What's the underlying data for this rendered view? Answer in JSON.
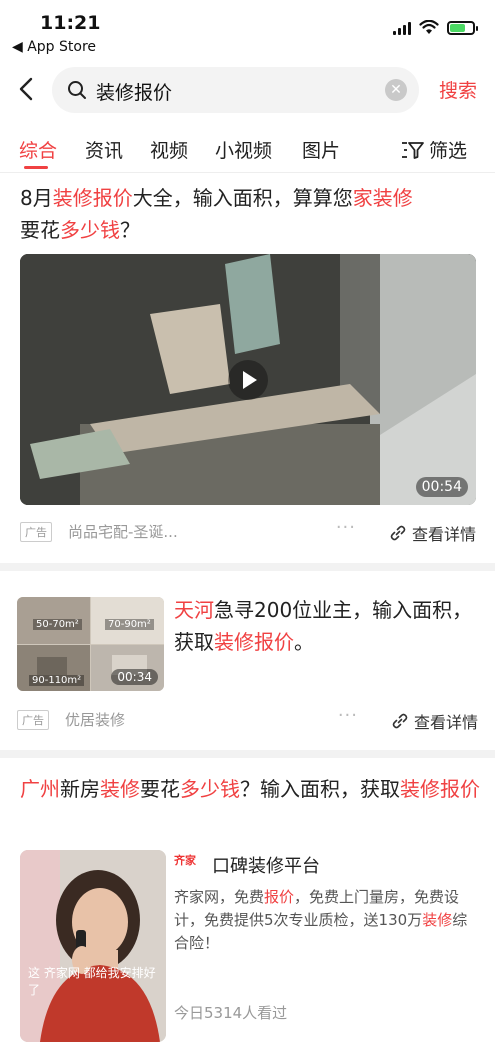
{
  "status_bar": {
    "time": "11:21",
    "back_app": "◀ App Store"
  },
  "search": {
    "query": "装修报价",
    "submit_label": "搜索"
  },
  "tabs": [
    {
      "label": "综合",
      "active": true
    },
    {
      "label": "资讯",
      "active": false
    },
    {
      "label": "视频",
      "active": false
    },
    {
      "label": "小视频",
      "active": false
    },
    {
      "label": "图片",
      "active": false
    }
  ],
  "filter_label": "筛选",
  "card1": {
    "title_parts": [
      "8月",
      "装修报价",
      "大全，输入面积，算算您",
      "家装修",
      "要花",
      "多少钱",
      "？"
    ],
    "duration": "00:54",
    "ad_tag": "广告",
    "advertiser": "尚品宅配-圣诞...",
    "more": "···",
    "detail_label": "查看详情"
  },
  "card2": {
    "title_parts": [
      "天河",
      "急寻200位业主，输入面积，获取",
      "装修报价",
      "。"
    ],
    "thumb_labels": [
      "50-70m²",
      "70-90m²",
      "90-110m²"
    ],
    "duration": "00:34",
    "ad_tag": "广告",
    "advertiser": "优居装修",
    "more": "···",
    "detail_label": "查看详情"
  },
  "card3": {
    "title_parts": [
      "广州",
      "新房",
      "装修",
      "要花",
      "多少钱",
      "？输入面积，获取",
      "装修报价"
    ],
    "image_caption": "这 齐家网 都给我安排好了",
    "brand_logo": "齐家",
    "brand_name": "口碑装修平台",
    "desc_parts": [
      "齐家网，免费",
      "报价",
      "，免费上门量房，免费设计，免费提供5次专业质检，送130万",
      "装修",
      "综合险！"
    ],
    "views": "今日5314人看过"
  },
  "colors": {
    "accent": "#f04142",
    "divider": "#f2f2f2",
    "muted": "#999999"
  }
}
